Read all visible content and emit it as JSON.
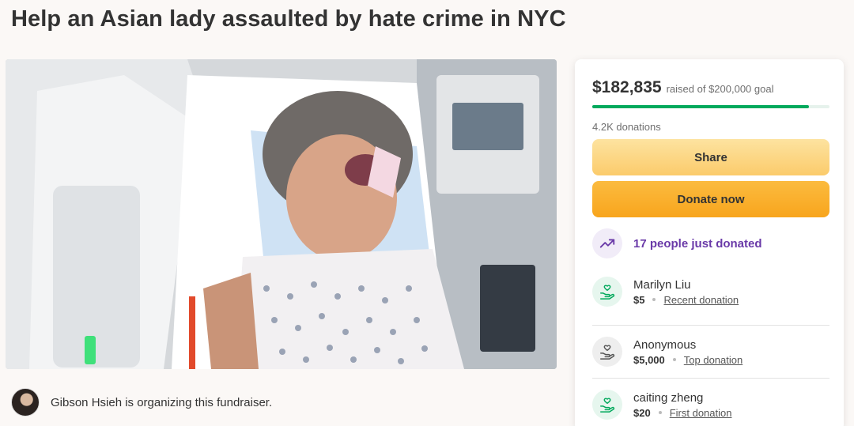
{
  "page": {
    "title": "Help an Asian lady assaulted by hate crime in NYC"
  },
  "organizer": {
    "text": "Gibson Hsieh is organizing this fundraiser."
  },
  "fundraiser": {
    "raised": "$182,835",
    "goal_text": "raised of $200,000 goal",
    "progress_fraction": 0.914,
    "donations_count": "4.2K donations",
    "share_label": "Share",
    "donate_label": "Donate now",
    "trend_text": "17 people just donated"
  },
  "donors": [
    {
      "name": "Marilyn Liu",
      "amount": "$5",
      "link": "Recent donation",
      "icon": "hand-heart-icon",
      "tone": "green"
    },
    {
      "name": "Anonymous",
      "amount": "$5,000",
      "link": "Top donation",
      "icon": "hand-heart-icon",
      "tone": "grey"
    },
    {
      "name": "caiting zheng",
      "amount": "$20",
      "link": "First donation",
      "icon": "hand-heart-icon",
      "tone": "green"
    }
  ],
  "colors": {
    "accent_green": "#02a95c",
    "trend_purple": "#6a3aa8",
    "donate_orange": "#f8a51d",
    "share_yellow": "#fbcb6b"
  }
}
